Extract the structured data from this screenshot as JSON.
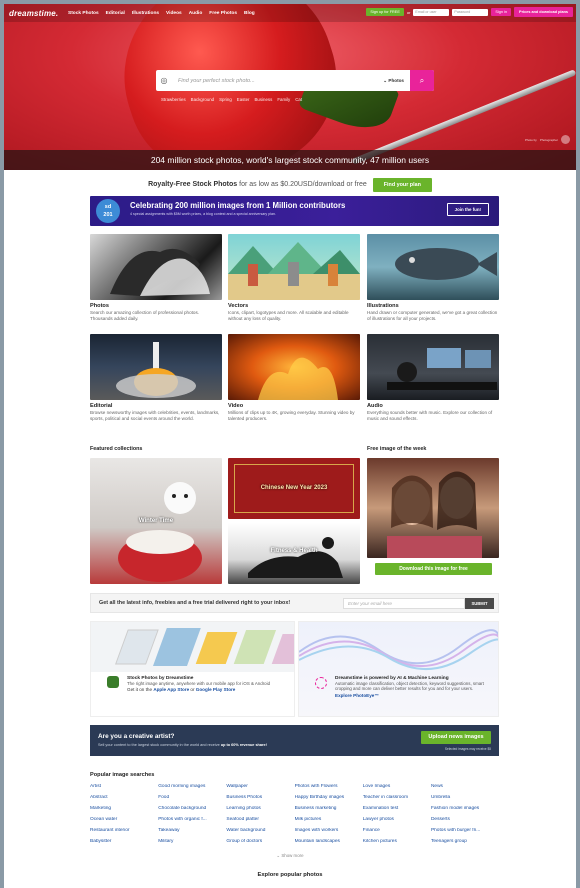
{
  "header": {
    "logo": "dreamstime.",
    "nav": [
      "Stock Photos",
      "Editorial",
      "Illustrations",
      "Videos",
      "Audio",
      "Free Photos",
      "Blog"
    ],
    "signup": "Sign up for FREE",
    "or": "or",
    "email_placeholder": "Email or user",
    "password_placeholder": "Password",
    "signin": "Sign in",
    "prices": "Prices and download plans"
  },
  "search": {
    "placeholder": "Find your perfect stock photo...",
    "type": "Photos",
    "tags": [
      "Strawberries",
      "Background",
      "Spring",
      "Easter",
      "Business",
      "Family",
      "Cat"
    ]
  },
  "hero": {
    "caption": "204 million stock photos, world's largest stock community, 47 million users",
    "credit_line1": "Photo by",
    "credit_line2": "Photographer"
  },
  "royalty": {
    "bold": "Royalty-Free Stock Photos",
    "rest": "for as low as $0.20USD/download or free",
    "button": "Find your plan"
  },
  "banner": {
    "badge_line1": "sd",
    "badge_line2": "201",
    "title": "Celebrating 200 million images from 1 Million contributors",
    "subtitle": "4 special assignments with $5M worth prizes, a blog contest and a special anniversary plan.",
    "button": "Join the fun!"
  },
  "categories": [
    {
      "title": "Photos",
      "desc": "Search our amazing collection of professional photos. Thousands added daily."
    },
    {
      "title": "Vectors",
      "desc": "Icons, clipart, logotypes and more. All scalable and editable without any loss of quality."
    },
    {
      "title": "Illustrations",
      "desc": "Hand drawn or computer generated, we've got a great collection of illustrations for all your projects."
    },
    {
      "title": "Editorial",
      "desc": "Browse newsworthy images with celebrities, events, landmarks, sports, political and social events around the world."
    },
    {
      "title": "Video",
      "desc": "Millions of clips up to 4K, growing everyday. Stunning video by talented producers."
    },
    {
      "title": "Audio",
      "desc": "Everything sounds better with music. Explore our collection of music and sound effects."
    }
  ],
  "featured": {
    "title": "Featured collections",
    "winter": "Winter Time",
    "chinese": "Chinese New Year 2023",
    "fitness": "Fitness & Health",
    "free_title": "Free image of the week",
    "download": "Download this image for free"
  },
  "newsletter": {
    "text": "Get all the latest info, freebies and a free trial delivered right to your inbox!",
    "placeholder": "Enter your email here",
    "button": "SUBMIT"
  },
  "app": {
    "title": "Stock Photos by Dreamstime",
    "desc": "The right image anytime, anywhere with our mobile app for iOS & Android",
    "get": "Get it on the",
    "apple": "Apple App Store",
    "or": "or",
    "google": "Google Play Store"
  },
  "ai": {
    "title": "Dreamstime is powered by AI & Machine Learning",
    "desc": "Automatic image classification, object detection, keyword suggestions, smart cropping and more can deliver better results for you and for your users.",
    "link": "Explore PhotoEye™"
  },
  "artist": {
    "title": "Are you a creative artist?",
    "sub_pre": "Sell your content to the largest stock community in the world and receive",
    "sub_bold": "up to 60% revenue share!",
    "button": "Upload news images",
    "note": "Selected images may receive $5"
  },
  "popular": {
    "title": "Popular image searches",
    "items": [
      "Artist",
      "Good morning images",
      "Wallpaper",
      "Photos with Flowers",
      "Love Images",
      "News",
      "Abstract",
      "Food",
      "Business Photos",
      "Happy Birthday images",
      "Teacher in classroom",
      "Umbrella",
      "Marketing",
      "Chocolate background",
      "Learning photos",
      "Business marketing",
      "Examination test",
      "Fashion model images",
      "Ocean water",
      "Photos with organic f...",
      "Seafood platter",
      "Milk pictures",
      "Lawyer photos",
      "Desserts",
      "Restaurant interior",
      "Takeaway",
      "Water background",
      "Images with workers",
      "Finance",
      "Photos with burger fri...",
      "Babysitter",
      "Military",
      "Group of doctors",
      "Mountain landscapes",
      "Kitchen pictures",
      "Teenagers group"
    ],
    "show_more": "Show more"
  },
  "explore": "Explore popular photos",
  "colors": {
    "pink": "#e9239a",
    "green": "#6ab42b",
    "navy": "#2b3a55",
    "purple": "#2c1c87",
    "link": "#1a4fa0"
  }
}
